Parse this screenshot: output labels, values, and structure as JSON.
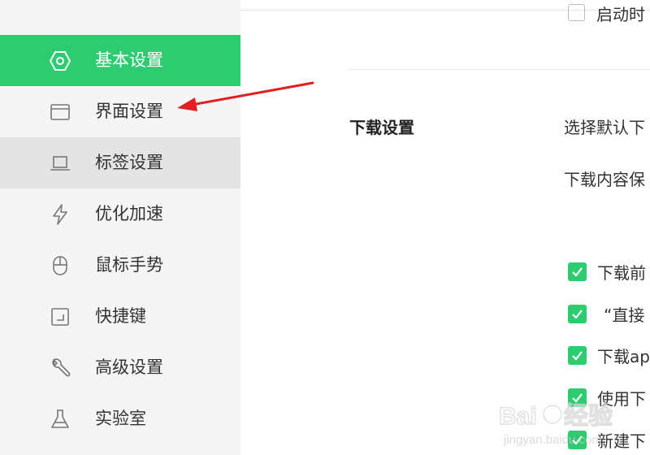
{
  "sidebar": {
    "items": [
      {
        "label": "基本设置",
        "icon": "hexagon-settings-icon",
        "state": "active"
      },
      {
        "label": "界面设置",
        "icon": "window-icon",
        "state": "normal"
      },
      {
        "label": "标签设置",
        "icon": "laptop-icon",
        "state": "hover"
      },
      {
        "label": "优化加速",
        "icon": "lightning-icon",
        "state": "normal"
      },
      {
        "label": "鼠标手势",
        "icon": "mouse-icon",
        "state": "normal"
      },
      {
        "label": "快捷键",
        "icon": "keyboard-shortcut-icon",
        "state": "normal"
      },
      {
        "label": "高级设置",
        "icon": "wrench-icon",
        "state": "normal"
      },
      {
        "label": "实验室",
        "icon": "flask-icon",
        "state": "normal"
      }
    ]
  },
  "main": {
    "top_option": {
      "label": "启动时",
      "checked": false
    },
    "download": {
      "title": "下载设置",
      "choose_default": "选择默认下",
      "save_location": "下载内容保",
      "options": [
        {
          "label": "下载前",
          "checked": true
        },
        {
          "label": "“直接",
          "checked": true
        },
        {
          "label": "下载ap",
          "checked": true
        },
        {
          "label": "使用下",
          "checked": true
        },
        {
          "label": "新建下",
          "checked": true
        }
      ]
    }
  },
  "colors": {
    "accent": "#2ecc71",
    "annotation_arrow": "#e02020"
  },
  "watermark": {
    "text": "Baidu经验",
    "sub": "jingyan.baidu.com"
  }
}
